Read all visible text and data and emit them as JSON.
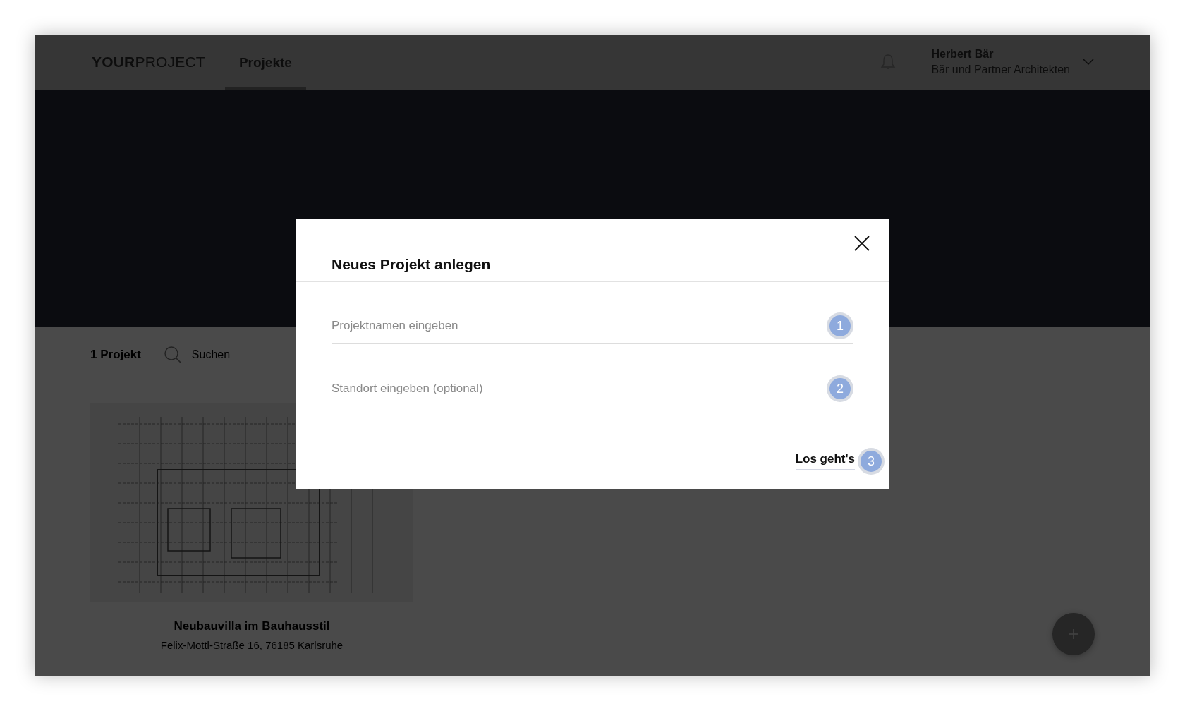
{
  "header": {
    "logo": {
      "bold": "YOUR",
      "light": "PROJECT"
    },
    "nav": [
      {
        "label": "Projekte",
        "selected": true
      }
    ],
    "user": {
      "name": "Herbert Bär",
      "company": "Bär und Partner Architekten"
    }
  },
  "toolbar": {
    "count": "1 Projekt",
    "search": {
      "placeholder": "Suchen"
    }
  },
  "projects": [
    {
      "name": "Neubauvilla im Bauhausstil",
      "address": "Felix-Mottl-Straße 16, 76185 Karlsruhe"
    }
  ],
  "modal": {
    "title": "Neues Projekt anlegen",
    "fields": [
      {
        "placeholder": "Projektnamen eingeben",
        "step": "1"
      },
      {
        "placeholder": "Standort eingeben (optional)",
        "step": "2"
      }
    ],
    "submit": {
      "label": "Los geht's",
      "step": "3"
    }
  }
}
